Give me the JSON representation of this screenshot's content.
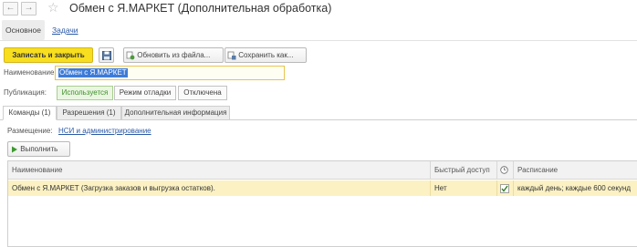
{
  "window": {
    "title": "Обмен с Я.МАРКЕТ (Дополнительная обработка)",
    "back_icon": "←",
    "forward_icon": "→",
    "favorite_icon": "☆"
  },
  "page_tabs": {
    "main": "Основное",
    "tasks": "Задачи"
  },
  "toolbar": {
    "write_close": "Записать и закрыть",
    "load_from_file": "Обновить из файла...",
    "save_as": "Сохранить как..."
  },
  "form": {
    "name_label": "Наименование:",
    "name_value": "Обмен с Я.МАРКЕТ",
    "publication_label": "Публикация:",
    "publication_options": [
      "Используется",
      "Режим отладки",
      "Отключена"
    ]
  },
  "detail_tabs": [
    "Команды (1)",
    "Разрешения (1)",
    "Дополнительная информация"
  ],
  "placement": {
    "label": "Размещение:",
    "link": "НСИ и администрирование"
  },
  "run_button": "Выполнить",
  "table": {
    "columns": [
      "Наименование",
      "Быстрый доступ",
      "",
      "Расписание"
    ],
    "rows": [
      {
        "name": "Обмен с Я.МАРКЕТ (Загрузка заказов и выгрузка остатков).",
        "quick_access": "Нет",
        "scheduled": true,
        "schedule": "каждый день; каждые 600 секунд"
      }
    ]
  },
  "colors": {
    "primary_button": "#f7de1f",
    "selected_row": "#fbf1c3",
    "link": "#2a59a6",
    "active_publication": "#3e8f2a"
  }
}
